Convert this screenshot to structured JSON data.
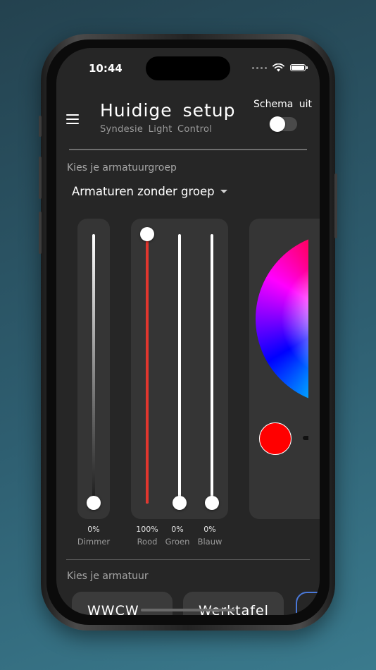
{
  "status_bar": {
    "time": "10:44"
  },
  "header": {
    "title": "Huidige setup",
    "subtitle": "Syndesie Light Control",
    "schema_label": "Schema uit",
    "schema_enabled": false
  },
  "group_section": {
    "label": "Kies je armatuurgroep",
    "selected_group": "Armaturen zonder groep"
  },
  "sliders": [
    {
      "name": "Dimmer",
      "value_text": "0%",
      "value": 0,
      "color": "#ffffff"
    },
    {
      "name": "Rood",
      "value_text": "100%",
      "value": 100,
      "color": "#e2362e"
    },
    {
      "name": "Groen",
      "value_text": "0%",
      "value": 0,
      "color": "#ffffff"
    },
    {
      "name": "Blauw",
      "value_text": "0%",
      "value": 0,
      "color": "#ffffff"
    }
  ],
  "color_picker": {
    "selected_color": "#ff0000"
  },
  "fixture_section": {
    "label": "Kies je armatuur",
    "chips": [
      "WWCW",
      "Werktafel"
    ]
  },
  "colors": {
    "accent": "#4a78d8",
    "red": "#e2362e",
    "background": "#262626"
  },
  "icons": [
    "menu-icon",
    "signal-dots-icon",
    "wifi-icon",
    "battery-icon",
    "caret-down-icon"
  ]
}
